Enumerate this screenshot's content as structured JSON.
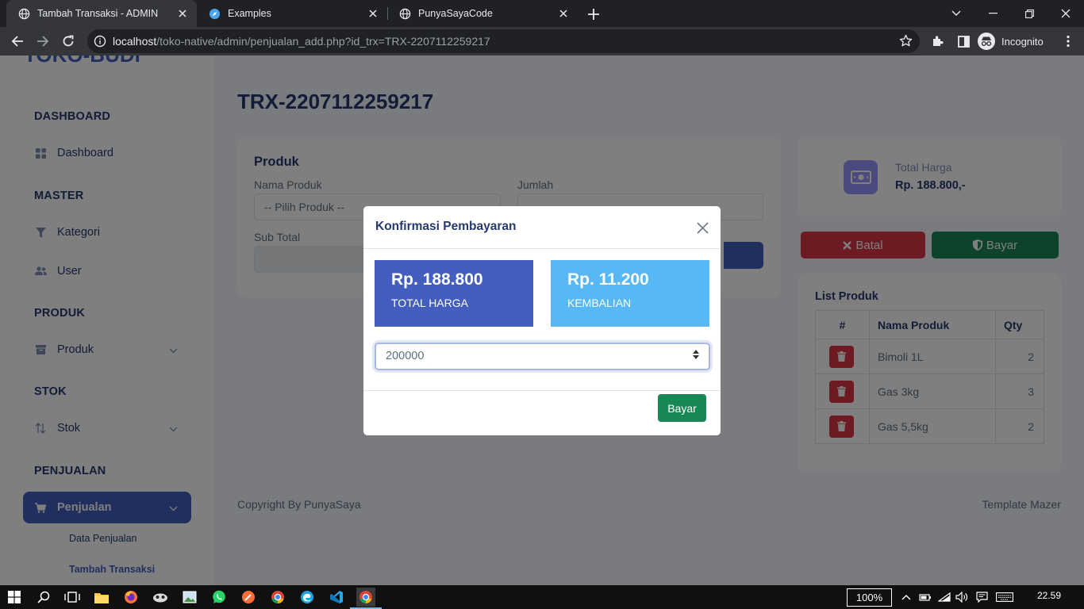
{
  "browser": {
    "tabs": [
      {
        "title": "Tambah Transaksi - ADMIN",
        "active": true
      },
      {
        "title": "Examples",
        "active": false
      },
      {
        "title": "PunyaSayaCode",
        "active": false
      }
    ],
    "url_host": "localhost",
    "url_path": "/toko-native/admin/penjualan_add.php?id_trx=TRX-2207112259217",
    "profile": "Incognito"
  },
  "sidebar": {
    "brand": "TOKO-BUDI",
    "sections": {
      "dashboard": "DASHBOARD",
      "master": "MASTER",
      "produk": "PRODUK",
      "stok": "STOK",
      "penjualan": "PENJUALAN"
    },
    "items": {
      "dashboard": "Dashboard",
      "kategori": "Kategori",
      "user": "User",
      "produk": "Produk",
      "stok": "Stok",
      "penjualan": "Penjualan"
    },
    "submenu": [
      "Data Penjualan",
      "Tambah Transaksi"
    ]
  },
  "main": {
    "title": "TRX-2207112259217",
    "produk_card": {
      "title": "Produk",
      "nama_produk_label": "Nama Produk",
      "nama_produk_value": "-- Pilih Produk --",
      "jumlah_label": "Jumlah",
      "jumlah_value": "",
      "subtotal_label": "Sub Total",
      "subtotal_value": ""
    },
    "total": {
      "label": "Total Harga",
      "value": "Rp. 188.800,-"
    },
    "buttons": {
      "batal": "Batal",
      "bayar": "Bayar"
    },
    "list": {
      "title": "List Produk",
      "headers": [
        "#",
        "Nama Produk",
        "Qty"
      ],
      "rows": [
        {
          "nama": "Bimoli 1L",
          "qty": "2"
        },
        {
          "nama": "Gas 3kg",
          "qty": "3"
        },
        {
          "nama": "Gas 5,5kg",
          "qty": "2"
        }
      ]
    },
    "footer_left": "Copyright By PunyaSaya",
    "footer_right": "Template Mazer"
  },
  "modal": {
    "title": "Konfirmasi Pembayaran",
    "total_amount": "Rp. 188.800",
    "total_caption": "TOTAL HARGA",
    "change_amount": "Rp. 11.200",
    "change_caption": "KEMBALIAN",
    "payment_value": "200000",
    "submit_label": "Bayar"
  },
  "taskbar": {
    "zoom": "100%",
    "time": "22.59"
  },
  "colors": {
    "primary": "#435ebe",
    "info": "#57b8f5",
    "danger": "#dc3545",
    "success": "#198754",
    "stat_icon": "#9694ff"
  }
}
